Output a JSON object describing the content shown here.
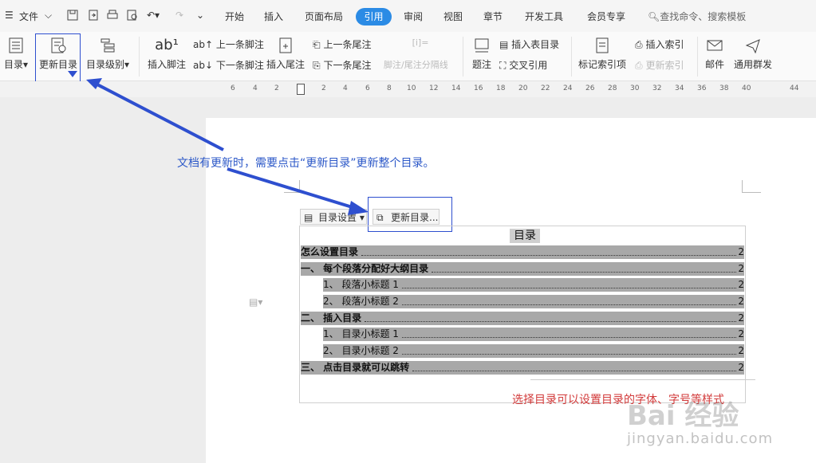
{
  "menu": {
    "file_label": "文件",
    "tabs": [
      "开始",
      "插入",
      "页面布局",
      "引用",
      "审阅",
      "视图",
      "章节",
      "开发工具",
      "会员专享"
    ],
    "active_tab": "引用",
    "search_placeholder": "查找命令、搜索模板"
  },
  "ribbon": {
    "toc": "目录",
    "update_toc": "更新目录",
    "toc_level": "目录级别",
    "insert_footnote": "插入脚注",
    "prev_footnote": "上一条脚注",
    "next_footnote": "下一条脚注",
    "insert_endnote": "插入尾注",
    "prev_endnote": "上一条尾注",
    "next_endnote": "下一条尾注",
    "separator": "脚注/尾注分隔线",
    "caption": "题注",
    "insert_table_of_figures": "插入表目录",
    "cross_reference": "交叉引用",
    "mark_index_entry": "标记索引项",
    "insert_index": "插入索引",
    "update_index": "更新索引",
    "mail": "邮件",
    "mass_mail": "通用群发"
  },
  "ruler_ticks": [
    "6",
    "4",
    "2",
    "2",
    "4",
    "6",
    "8",
    "10",
    "12",
    "14",
    "16",
    "18",
    "20",
    "22",
    "24",
    "26",
    "28",
    "30",
    "32",
    "34",
    "36",
    "38",
    "40",
    "44"
  ],
  "annotations": {
    "top": "文档有更新时，需要点击“更新目录”更新整个目录。",
    "bottom": "选择目录可以设置目录的字体、字号等样式"
  },
  "toc_controls": {
    "settings": "目录设置",
    "update": "更新目录..."
  },
  "toc": {
    "title": "目录",
    "entries": [
      {
        "level": 1,
        "text": "怎么设置目录",
        "page": "2"
      },
      {
        "level": 1,
        "text": "一、 每个段落分配好大纲目录",
        "page": "2"
      },
      {
        "level": 2,
        "text": "1、 段落小标题 1",
        "page": "2"
      },
      {
        "level": 2,
        "text": "2、 段落小标题 2",
        "page": "2"
      },
      {
        "level": 1,
        "text": "二、 插入目录",
        "page": "2"
      },
      {
        "level": 2,
        "text": "1、 目录小标题 1",
        "page": "2"
      },
      {
        "level": 2,
        "text": "2、 目录小标题 2",
        "page": "2"
      },
      {
        "level": 1,
        "text": "三、 点击目录就可以跳转",
        "page": "2"
      }
    ]
  },
  "watermark": {
    "brand": "Bai 经验",
    "url": "jingyan.baidu.com"
  },
  "colors": {
    "accent": "#2b8be5",
    "annotation_blue": "#2c58c8",
    "annotation_red": "#d23a3a",
    "highlight_box": "#2e4fcf",
    "toc_selection": "#a8a8a8"
  }
}
